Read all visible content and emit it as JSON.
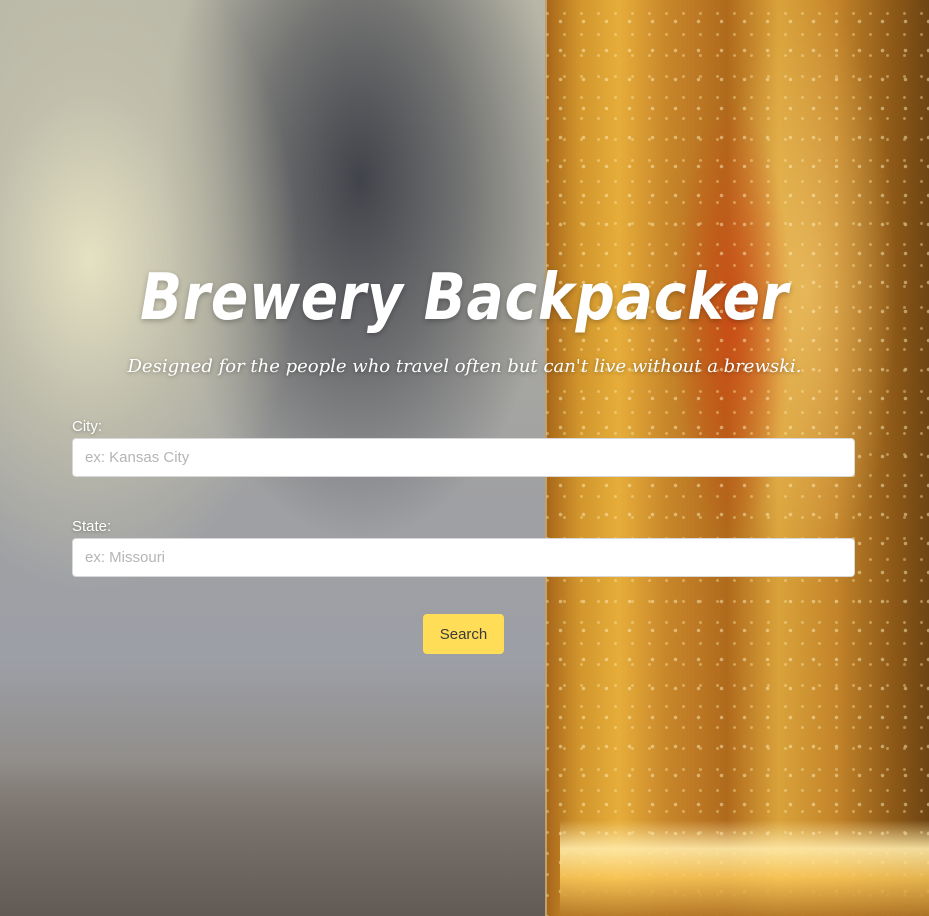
{
  "page": {
    "title": "Brewery Backpacker",
    "subtitle": "Designed for the people who travel often but can't live without a brewski."
  },
  "form": {
    "city": {
      "label": "City:",
      "value": "",
      "placeholder": "ex: Kansas City"
    },
    "state": {
      "label": "State:",
      "value": "",
      "placeholder": "ex: Missouri"
    },
    "search_label": "Search"
  },
  "colors": {
    "button_background": "#ffdd57",
    "text_on_background": "#ffffff",
    "placeholder": "#b5b5b5"
  }
}
